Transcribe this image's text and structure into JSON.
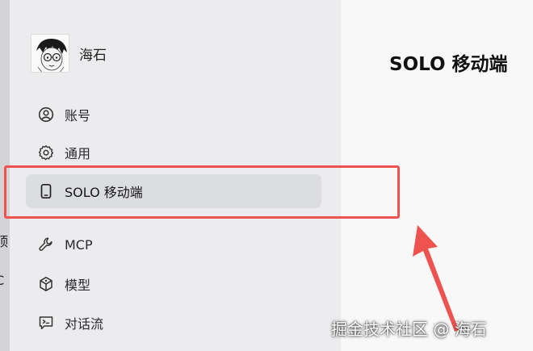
{
  "profile": {
    "name": "海石"
  },
  "nav": {
    "items": [
      {
        "label": "账号",
        "icon": "user-circle-icon",
        "active": false
      },
      {
        "label": "通用",
        "icon": "gear-icon",
        "active": false
      },
      {
        "label": "SOLO 移动端",
        "icon": "mobile-phone-icon",
        "active": true
      },
      {
        "label": "MCP",
        "icon": "wrench-icon",
        "active": false
      },
      {
        "label": "模型",
        "icon": "model-cube-icon",
        "active": false
      },
      {
        "label": "对话流",
        "icon": "chat-flow-icon",
        "active": false
      }
    ]
  },
  "main": {
    "title": "SOLO 移动端"
  },
  "annotation": {
    "box_color": "#ef5350",
    "arrow_color": "#ef5350"
  },
  "watermark": {
    "text": "掘金技术社区 @ 海石"
  },
  "left_edge": {
    "fragments": [
      "顶",
      "C"
    ]
  }
}
